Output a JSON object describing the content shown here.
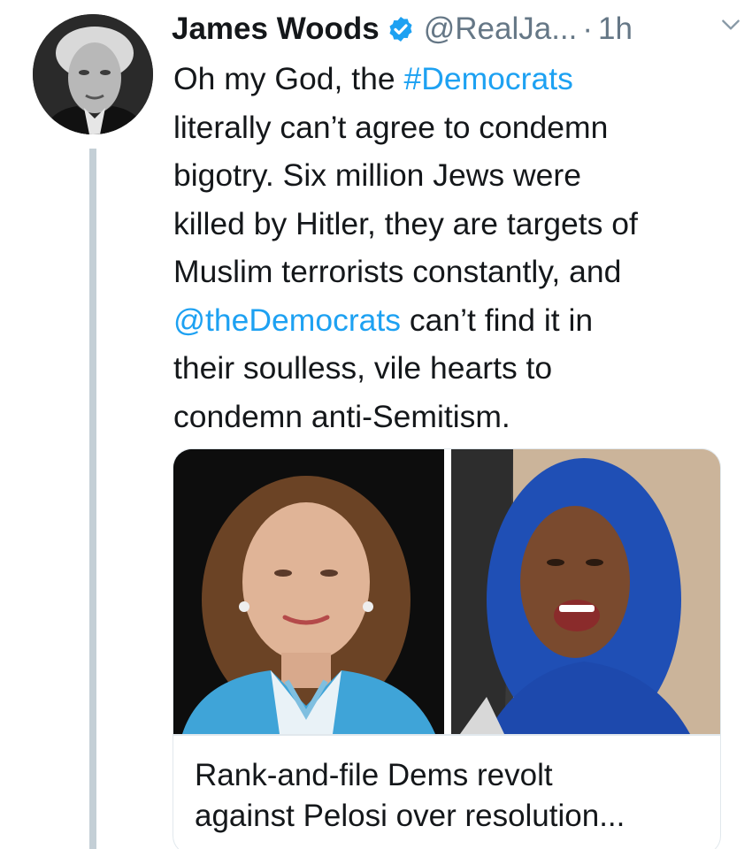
{
  "tweet": {
    "author_name": "James Woods",
    "handle": "@RealJa...",
    "separator": "·",
    "time": "1h",
    "verified_icon": "verified-badge-icon",
    "menu_icon": "chevron-down-icon",
    "avatar": "profile-photo",
    "accent_color": "#1da1f2",
    "text_lines": [
      {
        "pre": "Oh my God, the ",
        "link": "#Democrats",
        "post": ""
      },
      {
        "pre": "literally can’t agree to condemn",
        "link": "",
        "post": ""
      },
      {
        "pre": "bigotry. Six million Jews were",
        "link": "",
        "post": ""
      },
      {
        "pre": "killed by Hitler, they are targets of",
        "link": "",
        "post": ""
      },
      {
        "pre": "Muslim terrorists constantly, and",
        "link": "",
        "post": ""
      },
      {
        "pre": "",
        "link": "@theDemocrats",
        "post": " can’t find it in"
      },
      {
        "pre": "their soulless, vile hearts to",
        "link": "",
        "post": ""
      },
      {
        "pre": "condemn anti-Semitism.",
        "link": "",
        "post": ""
      }
    ]
  },
  "card": {
    "title_lines": [
      "Rank-and-file Dems revolt",
      "against Pelosi over resolution..."
    ]
  }
}
